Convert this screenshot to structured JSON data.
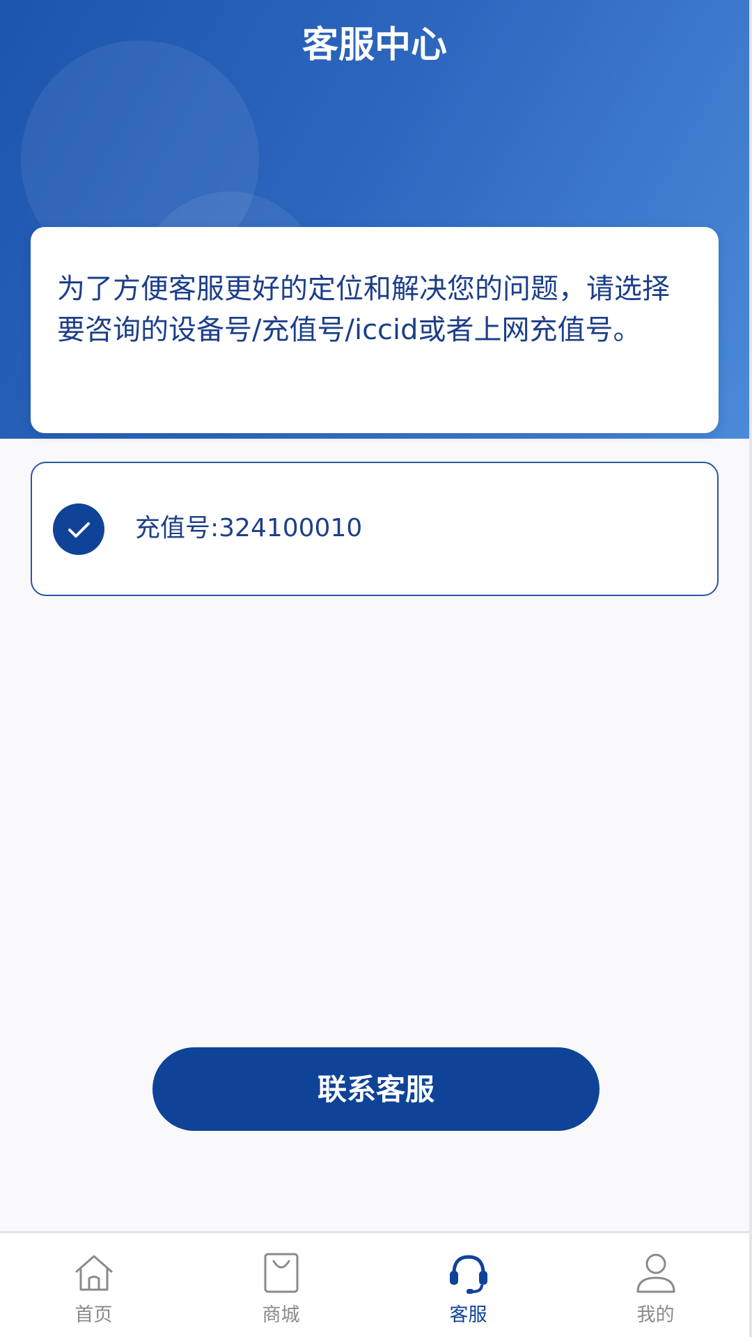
{
  "header": {
    "title": "客服中心"
  },
  "notice": {
    "text": "为了方便客服更好的定位和解决您的问题，请选择要咨询的设备号/充值号/iccid或者上网充值号。"
  },
  "options": [
    {
      "label": "充值号:324100010",
      "selected": true
    }
  ],
  "actions": {
    "contact_label": "联系客服"
  },
  "tabbar": {
    "items": [
      {
        "label": "首页",
        "icon": "home-icon",
        "active": false
      },
      {
        "label": "商城",
        "icon": "shopping-bag-icon",
        "active": false
      },
      {
        "label": "客服",
        "icon": "headset-icon",
        "active": true
      },
      {
        "label": "我的",
        "icon": "user-icon",
        "active": false
      }
    ]
  },
  "colors": {
    "primary": "#0e4398",
    "header_gradient_start": "#1c55ad",
    "header_gradient_end": "#4a8ad9",
    "text_primary": "#1c3f88",
    "tab_inactive": "#8a8a8e",
    "background": "#f9f9fb"
  }
}
